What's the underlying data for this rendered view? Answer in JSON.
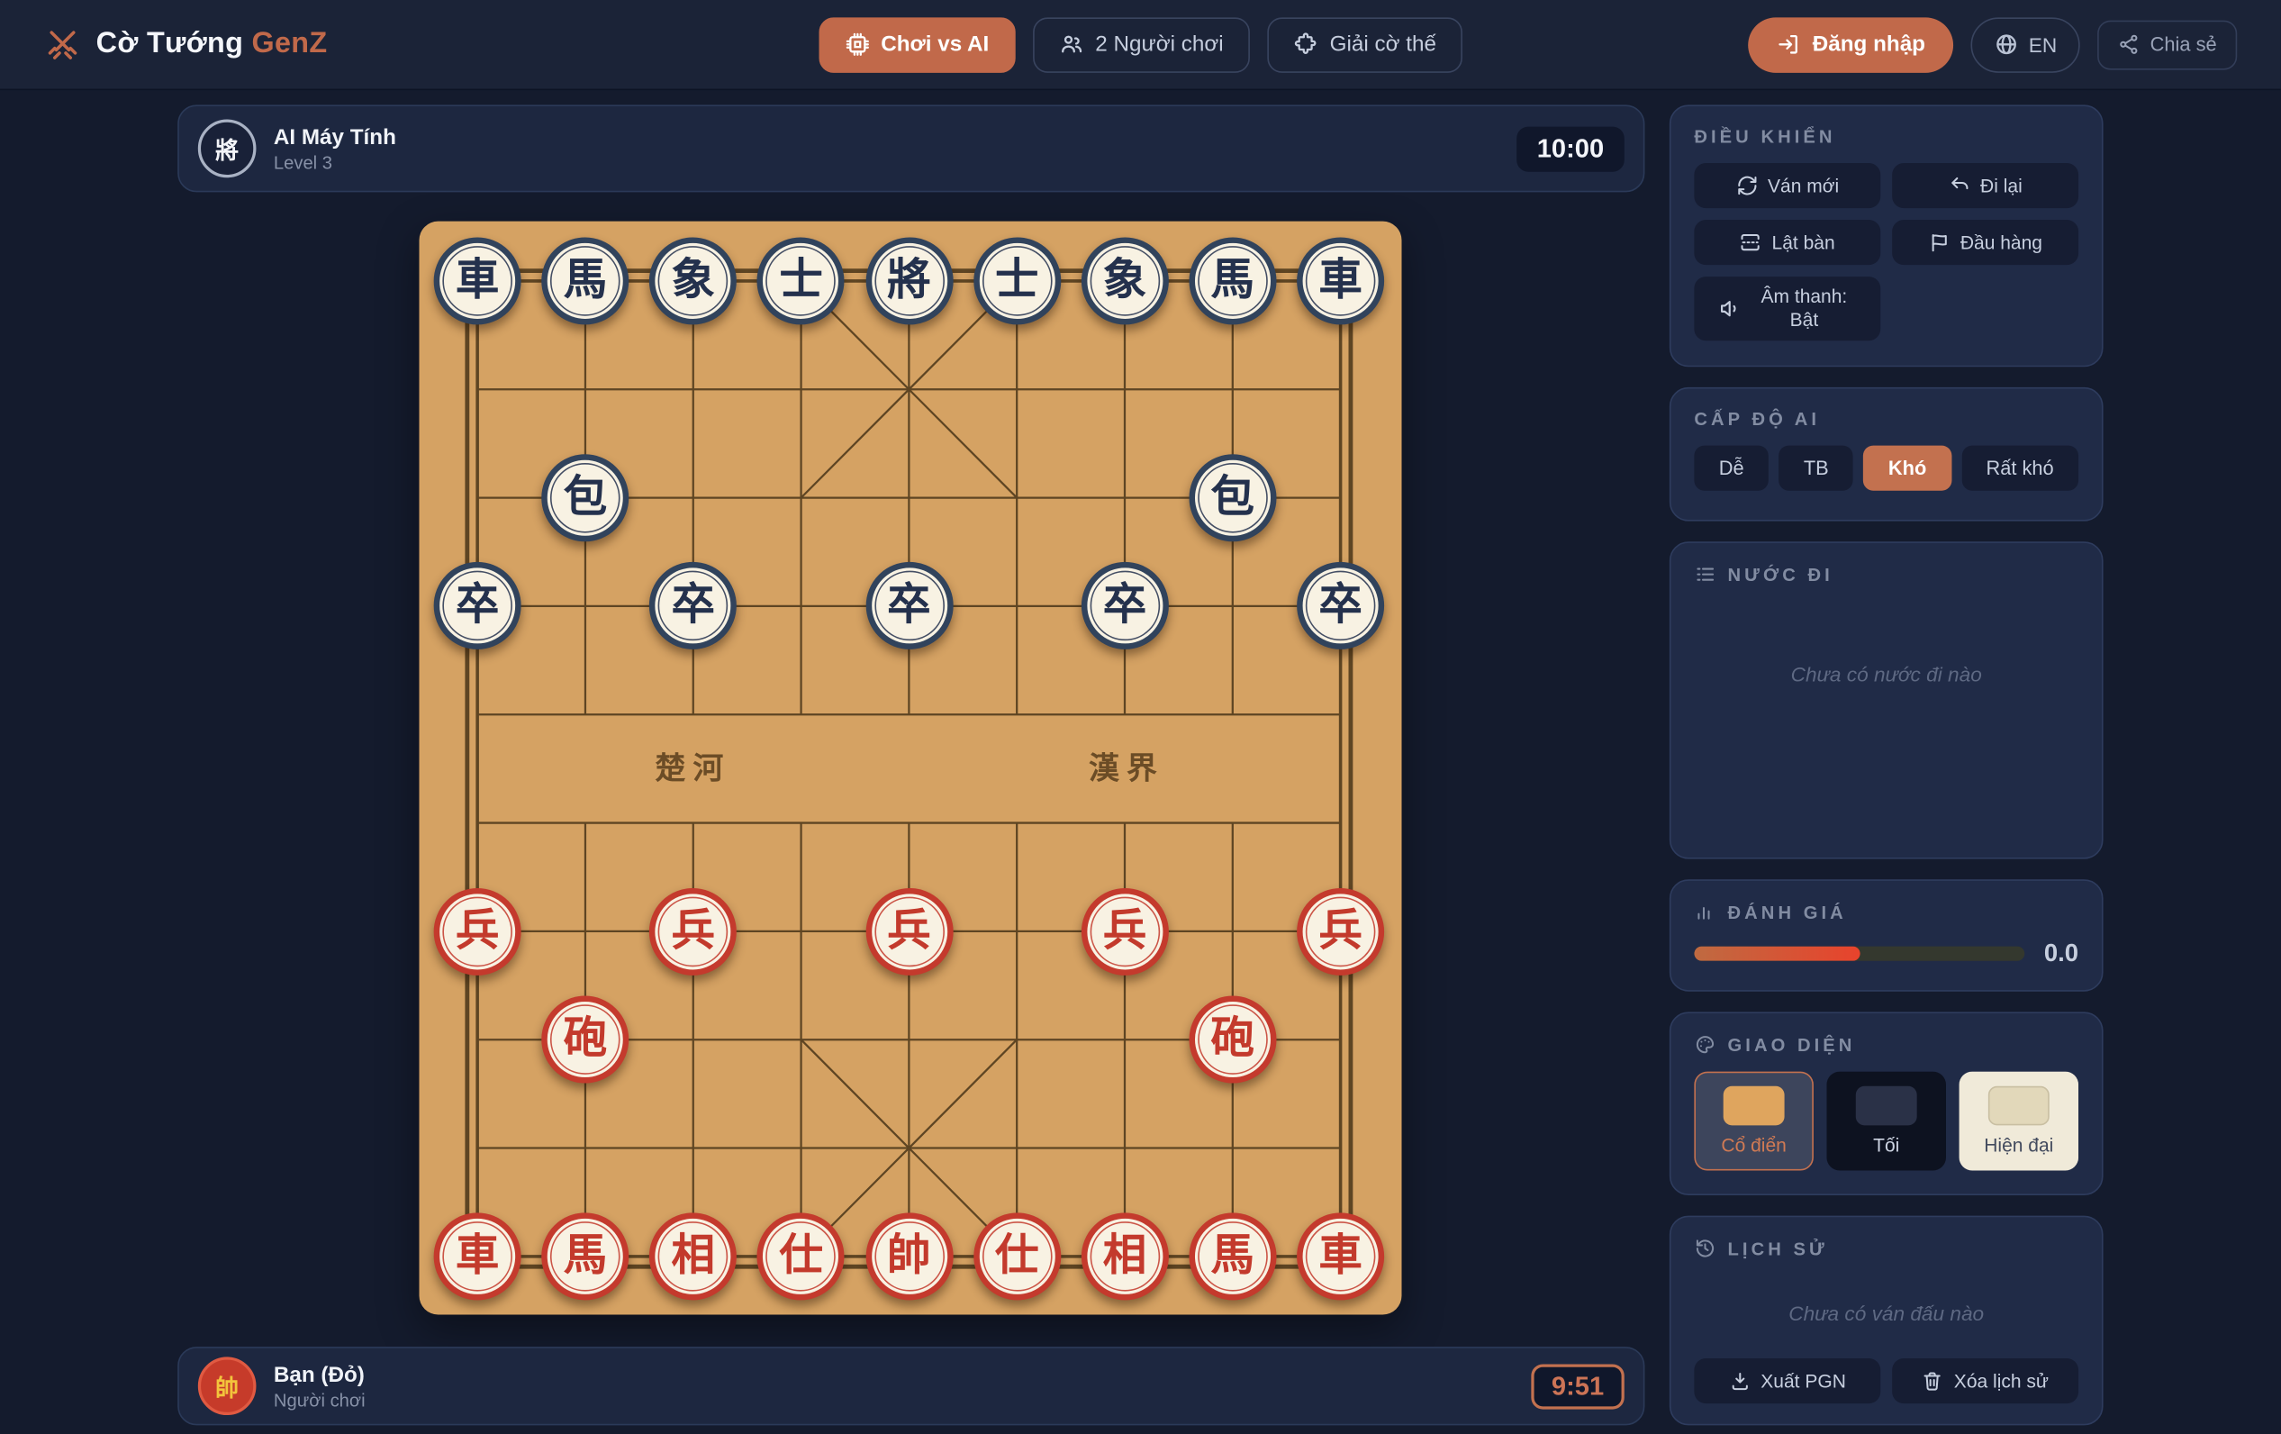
{
  "colors": {
    "accent": "#c1694a",
    "board_wood": "#d5a263",
    "board_line": "#5e4523",
    "red_piece": "#c43a2d",
    "black_piece": "#31435c",
    "active_timer": "#cd7456",
    "eval_fill_start": "#bf6a41",
    "eval_fill_end": "#e8432c"
  },
  "navbar": {
    "brand": {
      "title": "Cờ Tướng",
      "accent": "GenZ",
      "icon": "crossed-swords"
    },
    "tabs": [
      {
        "label": "Chơi vs AI",
        "icon": "cpu",
        "active": true
      },
      {
        "label": "2 Người chơi",
        "icon": "users",
        "active": false
      },
      {
        "label": "Giải cờ thế",
        "icon": "puzzle",
        "active": false
      }
    ],
    "login": "Đăng nhập",
    "language": "EN",
    "share": "Chia sẻ"
  },
  "top_player": {
    "name": "AI Máy Tính",
    "subtitle": "Level 3",
    "avatar": "將",
    "timer": "10:00"
  },
  "bottom_player": {
    "name": "Bạn (Đỏ)",
    "subtitle": "Người chơi",
    "avatar": "帥",
    "timer": "9:51"
  },
  "board": {
    "river_left": "楚河",
    "river_right": "漢界",
    "pieces": [
      {
        "r": 0,
        "c": 0,
        "t": "車",
        "s": "black"
      },
      {
        "r": 0,
        "c": 1,
        "t": "馬",
        "s": "black"
      },
      {
        "r": 0,
        "c": 2,
        "t": "象",
        "s": "black"
      },
      {
        "r": 0,
        "c": 3,
        "t": "士",
        "s": "black"
      },
      {
        "r": 0,
        "c": 4,
        "t": "將",
        "s": "black"
      },
      {
        "r": 0,
        "c": 5,
        "t": "士",
        "s": "black"
      },
      {
        "r": 0,
        "c": 6,
        "t": "象",
        "s": "black"
      },
      {
        "r": 0,
        "c": 7,
        "t": "馬",
        "s": "black"
      },
      {
        "r": 0,
        "c": 8,
        "t": "車",
        "s": "black"
      },
      {
        "r": 2,
        "c": 1,
        "t": "包",
        "s": "black"
      },
      {
        "r": 2,
        "c": 7,
        "t": "包",
        "s": "black"
      },
      {
        "r": 3,
        "c": 0,
        "t": "卒",
        "s": "black"
      },
      {
        "r": 3,
        "c": 2,
        "t": "卒",
        "s": "black"
      },
      {
        "r": 3,
        "c": 4,
        "t": "卒",
        "s": "black"
      },
      {
        "r": 3,
        "c": 6,
        "t": "卒",
        "s": "black"
      },
      {
        "r": 3,
        "c": 8,
        "t": "卒",
        "s": "black"
      },
      {
        "r": 6,
        "c": 0,
        "t": "兵",
        "s": "red"
      },
      {
        "r": 6,
        "c": 2,
        "t": "兵",
        "s": "red"
      },
      {
        "r": 6,
        "c": 4,
        "t": "兵",
        "s": "red"
      },
      {
        "r": 6,
        "c": 6,
        "t": "兵",
        "s": "red"
      },
      {
        "r": 6,
        "c": 8,
        "t": "兵",
        "s": "red"
      },
      {
        "r": 7,
        "c": 1,
        "t": "砲",
        "s": "red"
      },
      {
        "r": 7,
        "c": 7,
        "t": "砲",
        "s": "red"
      },
      {
        "r": 9,
        "c": 0,
        "t": "車",
        "s": "red"
      },
      {
        "r": 9,
        "c": 1,
        "t": "馬",
        "s": "red"
      },
      {
        "r": 9,
        "c": 2,
        "t": "相",
        "s": "red"
      },
      {
        "r": 9,
        "c": 3,
        "t": "仕",
        "s": "red"
      },
      {
        "r": 9,
        "c": 4,
        "t": "帥",
        "s": "red"
      },
      {
        "r": 9,
        "c": 5,
        "t": "仕",
        "s": "red"
      },
      {
        "r": 9,
        "c": 6,
        "t": "相",
        "s": "red"
      },
      {
        "r": 9,
        "c": 7,
        "t": "馬",
        "s": "red"
      },
      {
        "r": 9,
        "c": 8,
        "t": "車",
        "s": "red"
      }
    ]
  },
  "sidebar": {
    "controls": {
      "title": "ĐIỀU KHIỂN",
      "new_game": "Ván mới",
      "undo": "Đi lại",
      "flip": "Lật bàn",
      "resign": "Đầu hàng",
      "sound": "Âm thanh: Bật"
    },
    "difficulty": {
      "title": "CẤP ĐỘ AI",
      "options": [
        {
          "label": "Dễ",
          "active": false
        },
        {
          "label": "TB",
          "active": false
        },
        {
          "label": "Khó",
          "active": true
        },
        {
          "label": "Rất khó",
          "active": false
        }
      ]
    },
    "moves": {
      "title": "NƯỚC ĐI",
      "empty": "Chưa có nước đi nào"
    },
    "evaluation": {
      "title": "ĐÁNH GIÁ",
      "value": "0.0",
      "fill_percent": 50
    },
    "theme": {
      "title": "GIAO DIỆN",
      "options": [
        {
          "label": "Cổ điển",
          "active": true
        },
        {
          "label": "Tối",
          "active": false
        },
        {
          "label": "Hiện đại",
          "active": false
        }
      ]
    },
    "history": {
      "title": "LỊCH SỬ",
      "empty": "Chưa có ván đấu nào",
      "export": "Xuất PGN",
      "clear": "Xóa lịch sử"
    }
  }
}
